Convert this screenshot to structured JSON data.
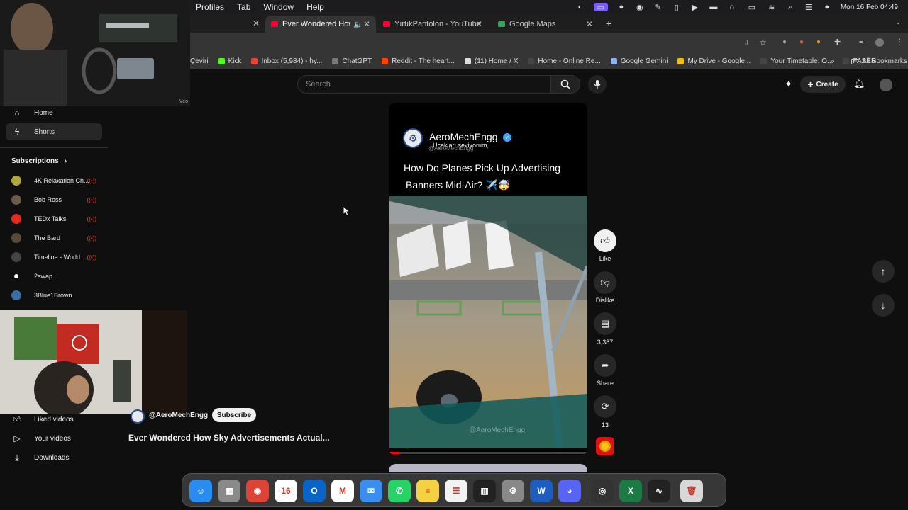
{
  "menubar": {
    "items": [
      "Profiles",
      "Tab",
      "Window",
      "Help"
    ],
    "datetime": "Mon 16 Feb  04:49"
  },
  "tabs": [
    {
      "title": "Ever Wondered How Sky",
      "active": true,
      "color": "#ff0033"
    },
    {
      "title": "YırtıkPantolon - YouTube",
      "active": false,
      "color": "#ff0033"
    },
    {
      "title": "Google Maps",
      "active": false,
      "color": "#34a853"
    }
  ],
  "bookmarks": [
    {
      "label": "Çeviri",
      "color": "#4285f4"
    },
    {
      "label": "Kick",
      "color": "#53fc18"
    },
    {
      "label": "Inbox (5,984) - hy...",
      "color": "#ea4335"
    },
    {
      "label": "ChatGPT",
      "color": "#777777"
    },
    {
      "label": "Reddit - The heart...",
      "color": "#ff4500"
    },
    {
      "label": "(11) Home / X",
      "color": "#dddddd"
    },
    {
      "label": "Home - Online Re...",
      "color": "#444444"
    },
    {
      "label": "Google Gemini",
      "color": "#8ab4f8"
    },
    {
      "label": "My Drive - Google...",
      "color": "#fbbc04"
    },
    {
      "label": "Your Timetable: O...",
      "color": "#444444"
    },
    {
      "label": "FASER",
      "color": "#444444"
    }
  ],
  "all_bookmarks": "All Bookmarks",
  "webcam_label": "Veo",
  "search": {
    "placeholder": "Search"
  },
  "create_label": "Create",
  "sidebar": {
    "home": "Home",
    "shorts": "Shorts",
    "subscriptions": "Subscriptions",
    "subs": [
      {
        "name": "4K Relaxation Ch...",
        "color": "#b5a83a",
        "live": true
      },
      {
        "name": "Bob Ross",
        "color": "#6b5b4b",
        "live": true
      },
      {
        "name": "TEDx Talks",
        "color": "#e62b1e",
        "live": true
      },
      {
        "name": "The Bard",
        "color": "#5a4a3a",
        "live": true
      },
      {
        "name": "Timeline - World ...",
        "color": "#444444",
        "live": true
      },
      {
        "name": "2swap",
        "color": "#000000",
        "live": false
      },
      {
        "name": "3Blue1Brown",
        "color": "#3a6ea5",
        "live": false
      }
    ],
    "liked": "Liked videos",
    "your_videos": "Your videos",
    "downloads": "Downloads"
  },
  "short": {
    "channel": "AeroMechEngg",
    "caption": "Uçakları seviyorum,",
    "handle_overlay": "@AeroMechEngg",
    "title_line1": "How Do Planes Pick Up Advertising",
    "title_line2": "Banners Mid-Air? ✈️🤯",
    "watermark": "@AeroMechEngg",
    "progress": 0.05
  },
  "under": {
    "handle": "@AeroMechEngg",
    "subscribe": "Subscribe",
    "title": "Ever Wondered How Sky Advertisements Actual..."
  },
  "actions": {
    "like": "Like",
    "dislike": "Dislike",
    "comments": "3,387",
    "share": "Share",
    "remix": "13"
  },
  "dock": [
    {
      "name": "finder",
      "glyph": "☺",
      "color": "#2a8cf0"
    },
    {
      "name": "launchpad",
      "glyph": "▦",
      "color": "#8a8a8a"
    },
    {
      "name": "chrome",
      "glyph": "◉",
      "color": "#db4437"
    },
    {
      "name": "calendar",
      "glyph": "16",
      "color": "#ffffff"
    },
    {
      "name": "outlook",
      "glyph": "O",
      "color": "#0a64c8"
    },
    {
      "name": "gmail",
      "glyph": "M",
      "color": "#ffffff"
    },
    {
      "name": "mail",
      "glyph": "✉",
      "color": "#3b8ef0"
    },
    {
      "name": "whatsapp",
      "glyph": "✆",
      "color": "#25d366"
    },
    {
      "name": "notes",
      "glyph": "≡",
      "color": "#f5d142"
    },
    {
      "name": "reminders",
      "glyph": "☰",
      "color": "#f2f2f2"
    },
    {
      "name": "sheets",
      "glyph": "▥",
      "color": "#222222"
    },
    {
      "name": "system-settings",
      "glyph": "⚙",
      "color": "#888888"
    },
    {
      "name": "word",
      "glyph": "W",
      "color": "#1e5dbf"
    },
    {
      "name": "discord",
      "glyph": "◕",
      "color": "#5865f2"
    },
    {
      "name": "obs",
      "glyph": "◎",
      "color": "#333333"
    },
    {
      "name": "excel",
      "glyph": "X",
      "color": "#1d7a45"
    },
    {
      "name": "activity-monitor",
      "glyph": "∿",
      "color": "#222222"
    },
    {
      "name": "trash",
      "glyph": "🗑",
      "color": "#d8d8d8"
    }
  ]
}
